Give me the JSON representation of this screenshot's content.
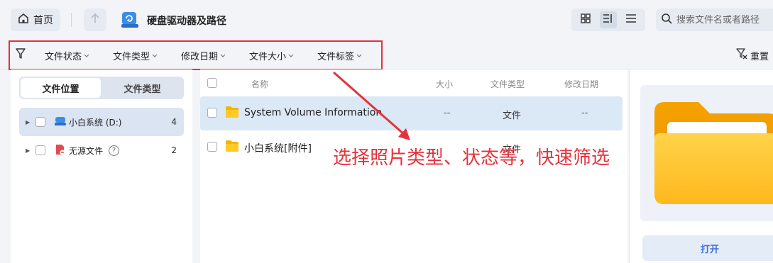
{
  "header": {
    "home_label": "首页",
    "path_title": "硬盘驱动器及路径",
    "search_placeholder": "搜索文件名或者路径"
  },
  "filters": {
    "items": [
      "文件状态",
      "文件类型",
      "修改日期",
      "文件大小",
      "文件标签"
    ],
    "reset_label": "重置"
  },
  "sidebar": {
    "tabs": [
      "文件位置",
      "文件类型"
    ],
    "tree": [
      {
        "label": "小白系统 (D:)",
        "count": "4"
      },
      {
        "label": "无源文件",
        "count": "2"
      }
    ]
  },
  "table": {
    "columns": [
      "名称",
      "大小",
      "文件类型",
      "修改日期"
    ],
    "rows": [
      {
        "name": "System Volume Information",
        "size": "--",
        "type": "文件",
        "date": "--"
      },
      {
        "name": "小白系统[附件]",
        "size": "",
        "type": "文件",
        "date": ""
      }
    ]
  },
  "preview": {
    "open_label": "打开"
  },
  "annotation": {
    "text": "选择照片类型、状态等，快速筛选"
  },
  "colors": {
    "accent": "#3a6fd8",
    "highlight": "#e5323b",
    "folder": "#f6b400"
  }
}
